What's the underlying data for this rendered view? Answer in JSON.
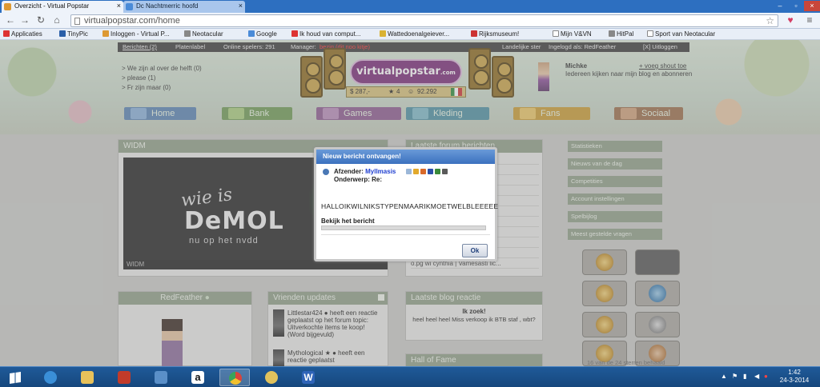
{
  "browser": {
    "tabs": [
      {
        "title": "Overzicht - Virtual Popstar"
      },
      {
        "title": "Dc Nachtmerric hoofd"
      }
    ],
    "url": "virtualpopstar.com/home",
    "bookmarks": [
      "Applicaties",
      "TinyPic",
      "Inloggen - Virtual P...",
      "Neotacular",
      "Google",
      "Ik houd van comput...",
      "Wattedoenalgeiever...",
      "Rijksmuseum!",
      "Mijn V&VN",
      "HitPal",
      "Sport van Neotacular"
    ]
  },
  "site": {
    "topnav": {
      "berichten": "Berichten (2)",
      "platenlabel": "Platenlabel",
      "online": "Online spelers: 291",
      "manager": "Manager:",
      "manager_status": "bezig (dit noo kitje)",
      "landelijke_ster": "Landelijke ster",
      "ingelogd": "Ingelogd als: RedFeather",
      "uitloggen": "[X] Uitloggen"
    },
    "left_links": [
      "> We zijn al over de helft (0)",
      "> please (1)",
      "> Fr zijn maar (0)"
    ],
    "logo": "virtualpopstar",
    "logo_suffix": ".com",
    "stats": {
      "money": "$ 287,-",
      "stars": "4",
      "fans": "92.292"
    },
    "profile": {
      "name": "Michke",
      "shout": "+ voeg shout toe",
      "desc": "Iedereen kijken naar mijn blog en abonneren"
    },
    "mainnav": [
      {
        "label": "Home",
        "color": "#5a83b3"
      },
      {
        "label": "Bank",
        "color": "#6f9a55"
      },
      {
        "label": "Games",
        "color": "#8c5a8f"
      },
      {
        "label": "Kleding",
        "color": "#4d8fa2"
      },
      {
        "label": "Fans",
        "color": "#c99b33"
      },
      {
        "label": "Sociaal",
        "color": "#9b6e4b"
      }
    ]
  },
  "widm": {
    "title": "WIDM",
    "line1": "wie is",
    "line2": "DeMOL",
    "line3": "nu op het nvdd",
    "caption": "WIDM"
  },
  "forum": {
    "title": "Laatste forum berichten",
    "rows": [
      "nderobel",
      "op! (Wer...",
      "tijn 20 ...",
      "tie t...",
      "",
      "| Niet ...",
      "",
      "e♥ | S...",
      "D PFR",
      "tijd b...",
      "o.pg wi cynthia | Vamesasti lic..."
    ]
  },
  "friends": {
    "title": "Vrienden updates",
    "items": [
      {
        "text": "Littlestar424 ● heeft een reactie geplaatst op het forum topic: Uitverkochte items te koop! (Word bijgevuld)"
      },
      {
        "text": "Mythological ★ ● heeft een reactie geplaatst"
      }
    ]
  },
  "redfeather": {
    "title": "RedFeather"
  },
  "blog": {
    "title": "Laatste blog reactie",
    "heading": "Ik zoek!",
    "text": "heel heel heel Miss verkoop ik BTB staf , wbt?"
  },
  "hof": {
    "title": "Hall of Fame"
  },
  "side_menu": [
    "Statistieken",
    "Nieuws van de dag",
    "Competities",
    "Account instellingen",
    "Spelbijlog",
    "Meest gestelde vragen"
  ],
  "awards_caption": "16 van de 24 sterren behaald",
  "modal": {
    "title": "Nieuw bericht ontvangen!",
    "from_label": "Afzender:",
    "from_name": "Myllmasis",
    "subject_label": "Onderwerp: Re:",
    "message": "HALLOIKWILNIKSTYPENMAARIKMOETWELBLEEEEE",
    "view_link": "Bekijk het bericht",
    "ok": "Ok"
  },
  "taskbar": {
    "apps": [
      {
        "name": "ie-icon",
        "color": "#3a8fd8"
      },
      {
        "name": "folder-icon",
        "color": "#e7c15a"
      },
      {
        "name": "media-icon",
        "color": "#c23b2a"
      },
      {
        "name": "remote-icon",
        "color": "#5a8fc8"
      },
      {
        "name": "amazon-icon",
        "color": "#ffffff"
      },
      {
        "name": "chrome-icon",
        "color": "#d9443b"
      },
      {
        "name": "paint-icon",
        "color": "#e0c25d"
      },
      {
        "name": "word-icon",
        "color": "#2f64b8"
      }
    ],
    "time": "1:42",
    "date": "24-3-2014"
  }
}
